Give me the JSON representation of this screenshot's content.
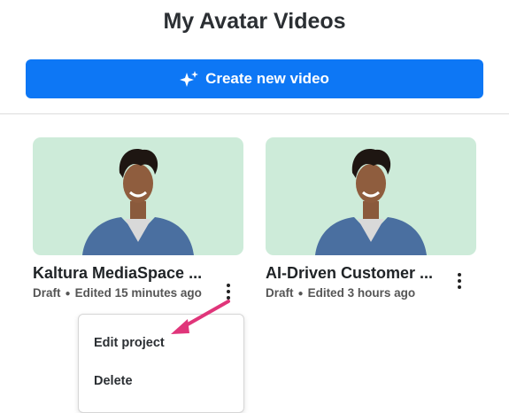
{
  "header": {
    "title": "My Avatar Videos"
  },
  "toolbar": {
    "create_label": "Create new video",
    "create_icon": "sparkle-icon",
    "accent": "#0d77f5"
  },
  "cards": [
    {
      "title": "Kaltura MediaSpace ...",
      "status": "Draft",
      "edited": "Edited 15 minutes ago",
      "thumb_color": "#cdebd9"
    },
    {
      "title": "AI-Driven Customer ...",
      "status": "Draft",
      "edited": "Edited 3 hours ago",
      "thumb_color": "#cdebd9"
    }
  ],
  "context_menu": {
    "items": [
      {
        "label": "Edit project"
      },
      {
        "label": "Delete"
      }
    ]
  },
  "annotation": {
    "arrow_color": "#e0357a",
    "arrow_icon": "pointer-arrow-icon"
  }
}
